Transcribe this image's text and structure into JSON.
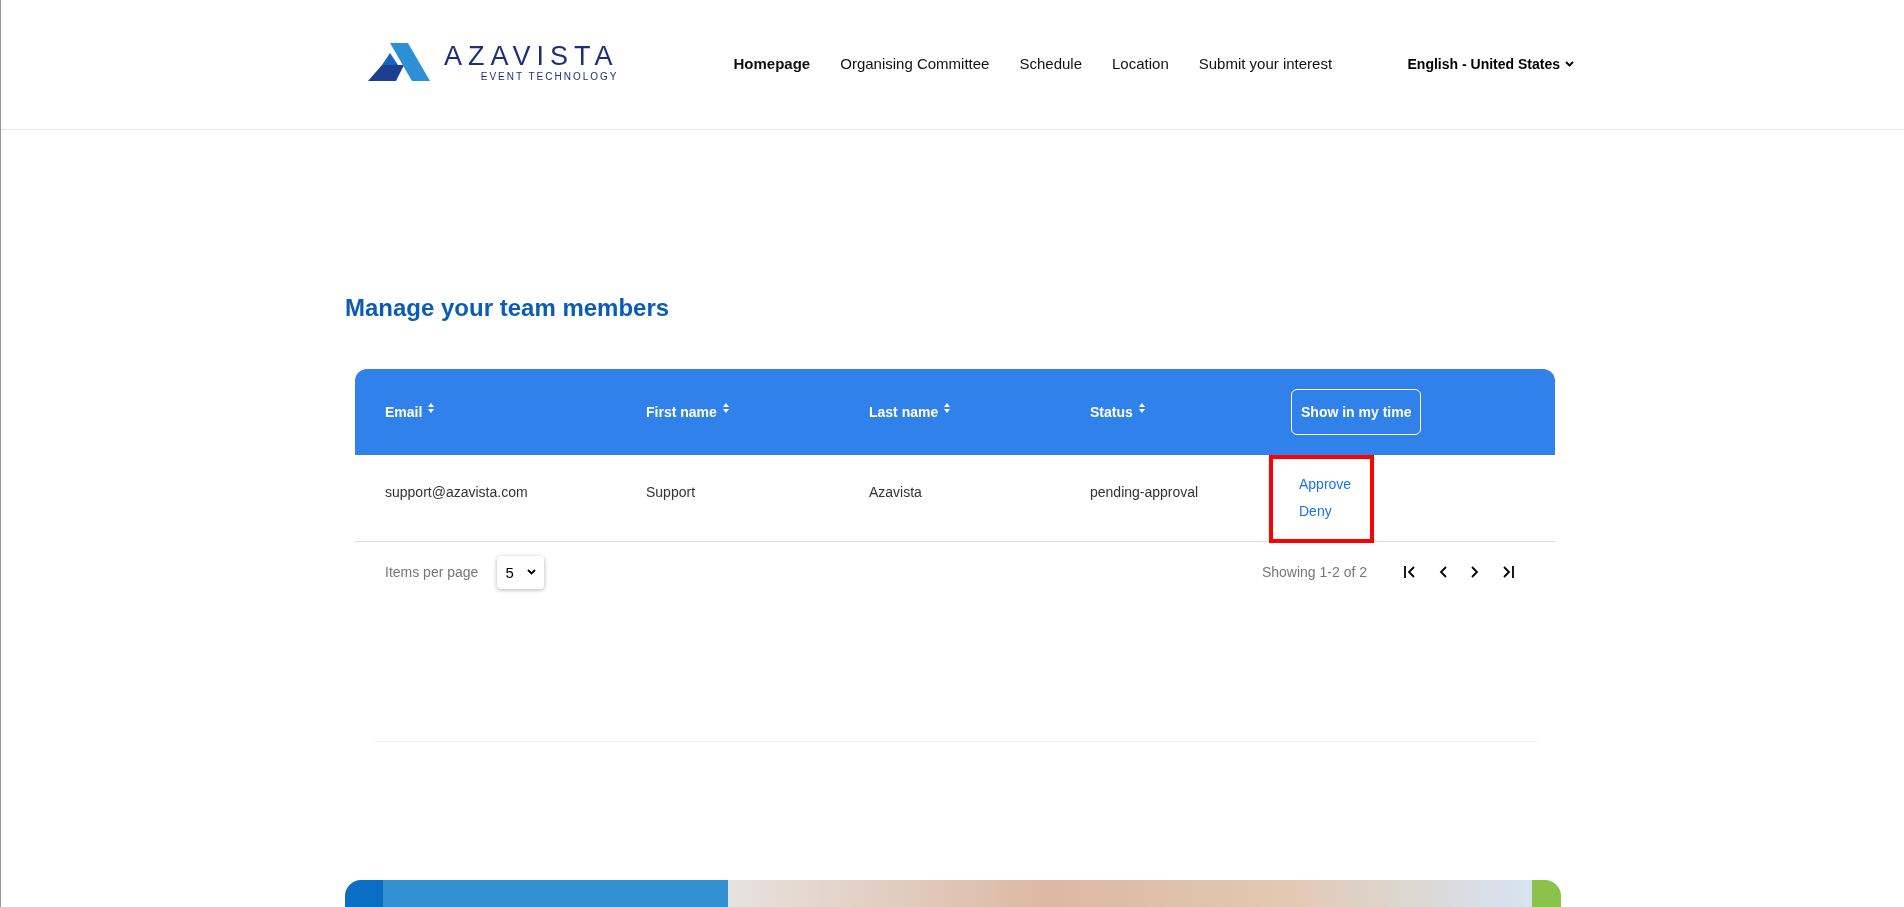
{
  "header": {
    "logo": {
      "name": "AZAVISTA",
      "tagline": "EVENT TECHNOLOGY"
    },
    "nav": [
      {
        "label": "Homepage",
        "selected": true
      },
      {
        "label": "Organising Committee",
        "selected": false
      },
      {
        "label": "Schedule",
        "selected": false
      },
      {
        "label": "Location",
        "selected": false
      },
      {
        "label": "Submit your interest",
        "selected": false
      }
    ],
    "language": "English - United States"
  },
  "page_title": "Manage your team members",
  "table": {
    "columns": [
      {
        "label": "Email",
        "kind": "sortable"
      },
      {
        "label": "First name",
        "kind": "sortable"
      },
      {
        "label": "Last name",
        "kind": "sortable"
      },
      {
        "label": "Status",
        "kind": "sortable"
      },
      {
        "label": "Show in my time",
        "kind": "button"
      }
    ],
    "rows": [
      {
        "cells": [
          "support@azavista.com",
          "Support",
          "Azavista",
          "pending-approval"
        ],
        "actions": [
          "Approve",
          "Deny"
        ],
        "highlighted": true
      }
    ],
    "footer": {
      "items_per_page_label": "Items per page",
      "items_per_page": "5",
      "showing": "Showing 1-2 of 2"
    }
  }
}
